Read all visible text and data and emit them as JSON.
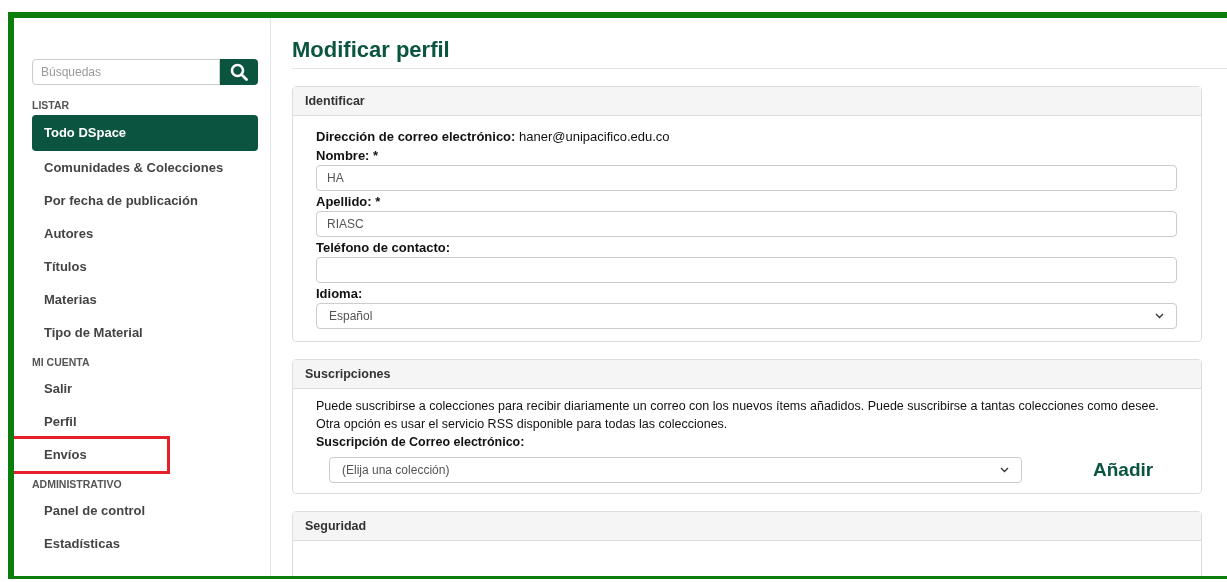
{
  "sidebar": {
    "search": {
      "placeholder": "Búsquedas"
    },
    "sections": [
      {
        "heading": "LISTAR",
        "items": [
          {
            "label": "Todo DSpace",
            "selected": true,
            "highlighted": false
          },
          {
            "label": "Comunidades & Colecciones",
            "selected": false,
            "highlighted": false
          },
          {
            "label": "Por fecha de publicación",
            "selected": false,
            "highlighted": false
          },
          {
            "label": "Autores",
            "selected": false,
            "highlighted": false
          },
          {
            "label": "Títulos",
            "selected": false,
            "highlighted": false
          },
          {
            "label": "Materias",
            "selected": false,
            "highlighted": false
          },
          {
            "label": "Tipo de Material",
            "selected": false,
            "highlighted": false
          }
        ]
      },
      {
        "heading": "MI CUENTA",
        "items": [
          {
            "label": "Salir",
            "selected": false,
            "highlighted": false
          },
          {
            "label": "Perfil",
            "selected": false,
            "highlighted": false
          },
          {
            "label": "Envíos",
            "selected": false,
            "highlighted": true
          }
        ]
      },
      {
        "heading": "ADMINISTRATIVO",
        "items": [
          {
            "label": "Panel de control",
            "selected": false,
            "highlighted": false
          },
          {
            "label": "Estadísticas",
            "selected": false,
            "highlighted": false
          }
        ]
      }
    ]
  },
  "page_title": "Modificar perfil",
  "identify": {
    "title": "Identificar",
    "email_label": "Dirección de correo electrónico:",
    "email": "haner@unipacifico.edu.co",
    "fields": [
      {
        "kind": "input",
        "label": "Nombre: *",
        "value": "HA"
      },
      {
        "kind": "input",
        "label": "Apellido: *",
        "value": "RIASC"
      },
      {
        "kind": "input",
        "label": "Teléfono de contacto:"
      },
      {
        "kind": "select",
        "label": "Idioma:",
        "value": "Español"
      }
    ]
  },
  "subscriptions": {
    "title": "Suscripciones",
    "text": "Puede suscribirse a colecciones para recibir diariamente un correo con los nuevos ítems añadidos. Puede suscribirse a tantas colecciones como desee. Otra opción es usar el servicio RSS disponible para todas las colecciones.",
    "label": "Suscripción de Correo electrónico:",
    "select": "(Elija una colección)",
    "add": "Añadir"
  },
  "security": {
    "title": "Seguridad"
  }
}
